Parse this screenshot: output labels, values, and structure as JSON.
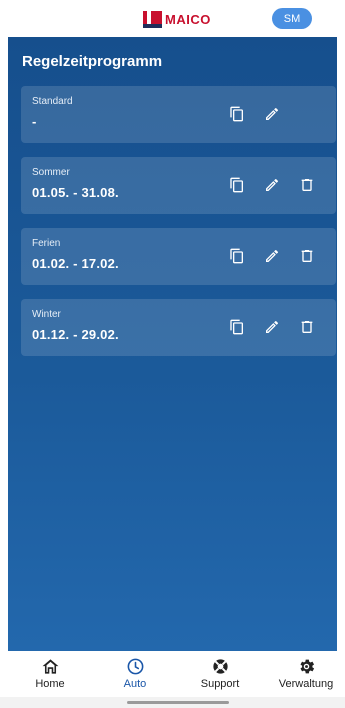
{
  "header": {
    "logo_text": "MAICO",
    "avatar_initials": "SM"
  },
  "page": {
    "title": "Regelzeitprogramm"
  },
  "programs": [
    {
      "name": "Standard",
      "range": "-",
      "actions": [
        "copy-icon",
        "edit-icon"
      ]
    },
    {
      "name": "Sommer",
      "range": "01.05. - 31.08.",
      "actions": [
        "copy-icon",
        "edit-icon",
        "delete-icon"
      ]
    },
    {
      "name": "Ferien",
      "range": "01.02. - 17.02.",
      "actions": [
        "copy-icon",
        "edit-icon",
        "delete-icon"
      ]
    },
    {
      "name": "Winter",
      "range": "01.12. - 29.02.",
      "actions": [
        "copy-icon",
        "edit-icon",
        "delete-icon"
      ]
    }
  ],
  "nav": [
    {
      "label": "Home",
      "icon": "home-icon",
      "active": false
    },
    {
      "label": "Auto",
      "icon": "clock-icon",
      "active": true
    },
    {
      "label": "Support",
      "icon": "lifebuoy-icon",
      "active": false
    },
    {
      "label": "Verwaltung",
      "icon": "gear-icon",
      "active": false
    }
  ],
  "colors": {
    "brand_red": "#c8102e",
    "background_blue": "#1b5a9a",
    "accent_blue": "#1a56a8",
    "avatar_blue": "#4a90e2"
  }
}
